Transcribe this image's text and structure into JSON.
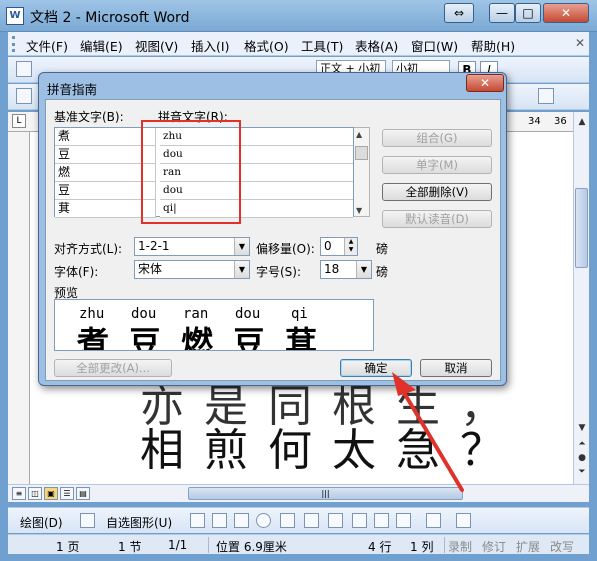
{
  "window": {
    "title": "文档 2 - Microsoft Word",
    "app_icon": "W",
    "controls": {
      "restore": "⇔",
      "minimize": "—",
      "maximize": "□",
      "close": "✕"
    }
  },
  "menu": {
    "items": [
      "文件(F)",
      "编辑(E)",
      "视图(V)",
      "插入(I)",
      "格式(O)",
      "工具(T)",
      "表格(A)",
      "窗口(W)",
      "帮助(H)"
    ],
    "close_doc": "✕"
  },
  "toolbar": {
    "style_box": "正文 + 小初",
    "font_box": "小初",
    "bold": "B",
    "italic": "I"
  },
  "ruler": {
    "ticks": [
      "34",
      "36"
    ]
  },
  "document": {
    "line1": "亦是同根生，",
    "line2": "相煎何太急？"
  },
  "dialog": {
    "title": "拼音指南",
    "close": "✕",
    "base_text_label": "基准文字(B):",
    "phonetic_label": "拼音文字(R):",
    "rows": [
      {
        "base": "煮",
        "py": "zhu"
      },
      {
        "base": "豆",
        "py": "dou"
      },
      {
        "base": "燃",
        "py": "ran"
      },
      {
        "base": "豆",
        "py": "dou"
      },
      {
        "base": "萁",
        "py": "qi|"
      }
    ],
    "buttons": {
      "group": "组合(G)",
      "single": "单字(M)",
      "remove_all": "全部删除(V)",
      "default_reading": "默认读音(D)",
      "change_all": "全部更改(A)...",
      "ok": "确定",
      "cancel": "取消"
    },
    "alignment_label": "对齐方式(L):",
    "alignment_value": "1-2-1",
    "offset_label": "偏移量(O):",
    "offset_value": "0",
    "offset_unit": "磅",
    "font_label": "字体(F):",
    "font_value": "宋体",
    "size_label": "字号(S):",
    "size_value": "18",
    "size_unit": "磅",
    "preview_label": "预览",
    "preview_pinyin": [
      "zhu",
      "dou",
      "ran",
      "dou",
      "qi"
    ],
    "preview_chars": [
      "煮",
      "豆",
      "燃",
      "豆",
      "萁"
    ]
  },
  "drawbar": {
    "draw": "绘图(D)",
    "autoshapes": "自选图形(U)"
  },
  "status": {
    "page": "1 页",
    "section": "1 节",
    "pages": "1/1",
    "position": "位置 6.9厘米",
    "line": "4 行",
    "column": "1 列",
    "rec": "录制",
    "trk": "修订",
    "ext": "扩展",
    "ovr": "改写"
  },
  "colors": {
    "highlight_box": "#e0322a",
    "arrow": "#e0322a",
    "frame": "#9cbfe3"
  }
}
